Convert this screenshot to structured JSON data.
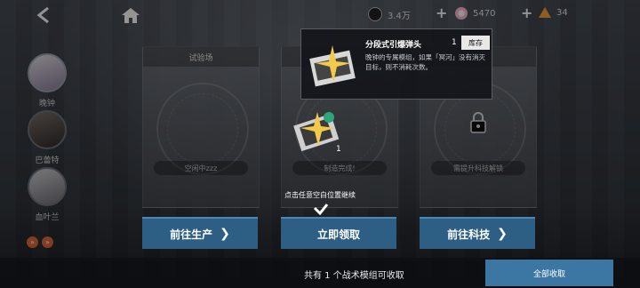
{
  "top": {
    "currency1": "3.4万",
    "currency2": "5470",
    "currency3": "34"
  },
  "sidebar": {
    "characters": [
      {
        "name": "晚钟"
      },
      {
        "name": "巴蕾特"
      },
      {
        "name": "血叶兰"
      }
    ]
  },
  "cards": [
    {
      "title": "试验场",
      "status": "空闲中zzz",
      "button": "前往生产"
    },
    {
      "title": "",
      "status": "制造完成!",
      "button": "立即领取"
    },
    {
      "title": "",
      "status": "需提升科技解锁",
      "button": "前往科技"
    }
  ],
  "popup": {
    "title": "分段式引爆弹头",
    "qty": "1",
    "inventory": "库存",
    "desc": "晚钟的专属模组，如果「冥河」没有消灭目标，则不消耗次数。"
  },
  "item": {
    "count": "1"
  },
  "hint": "点击任意空白位置继续",
  "footer": {
    "claim_text": "共有 1 个战术模组可收取",
    "all_claim": "全部收取"
  },
  "colors": {
    "accent_blue": "#2d5e83",
    "orange_tag": "#e06a3a"
  }
}
